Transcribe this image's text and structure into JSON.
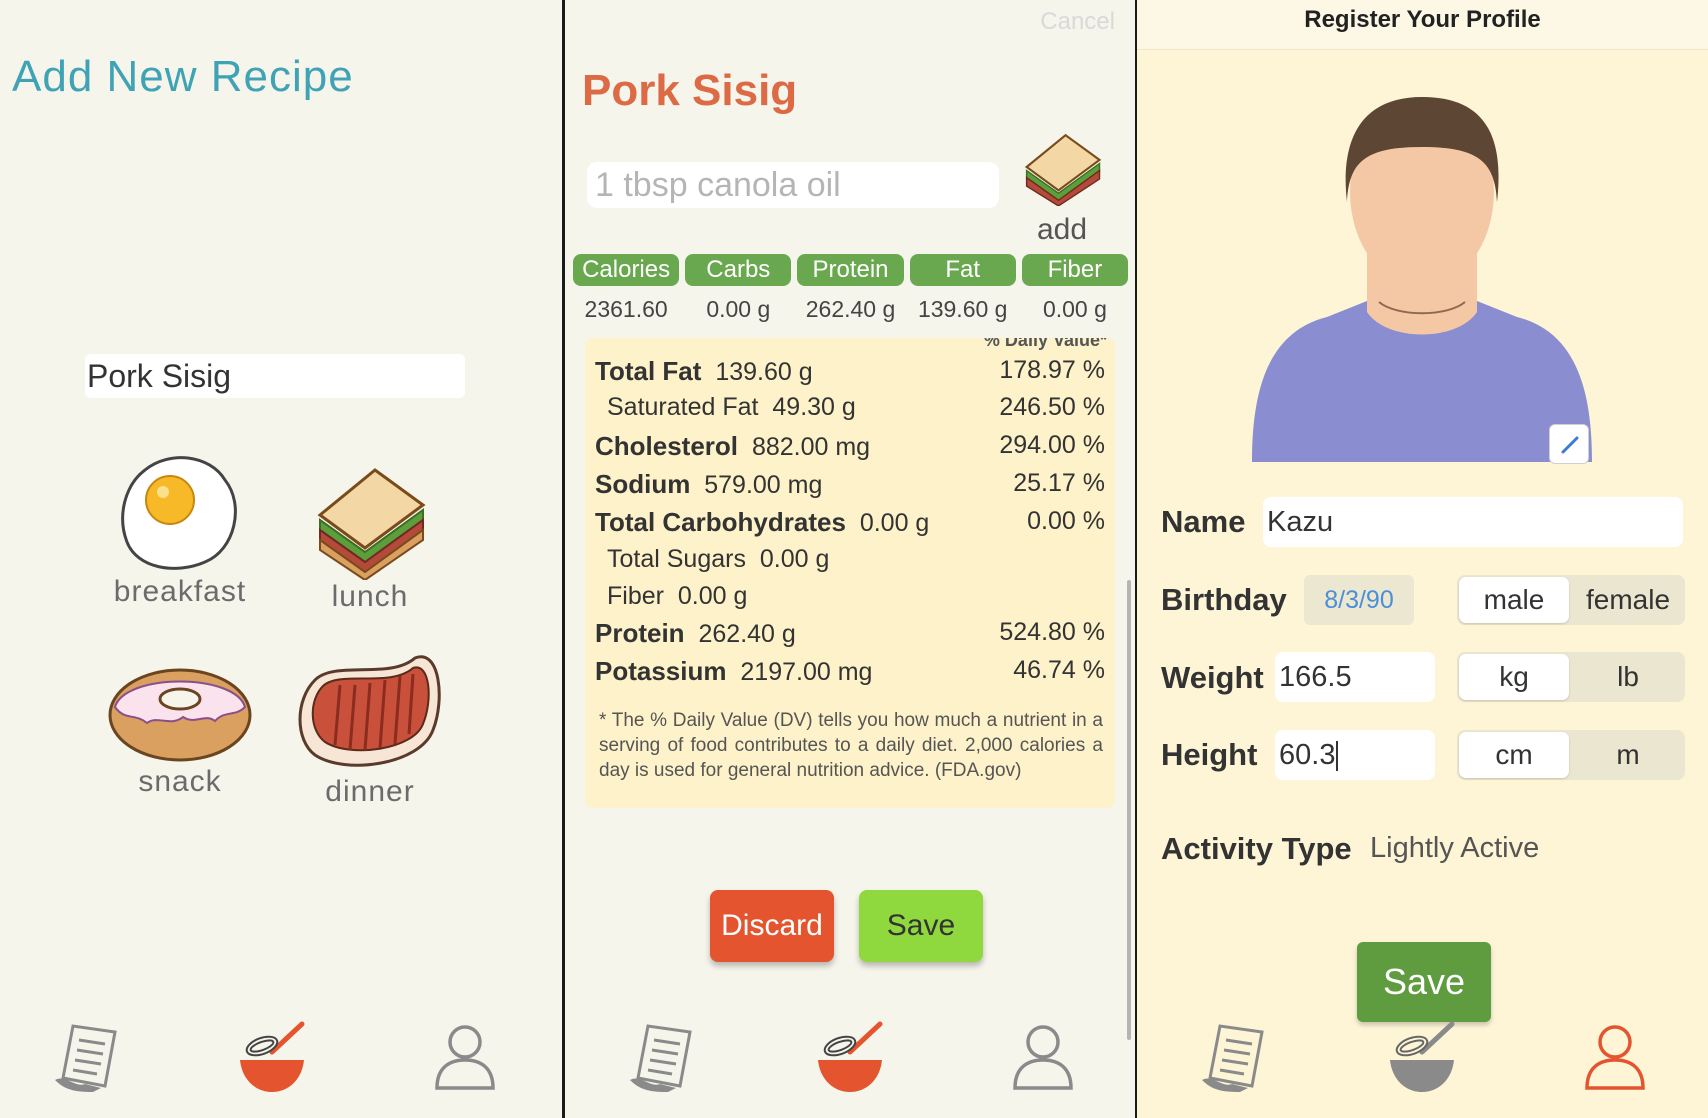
{
  "recipe_panel": {
    "title": "Add New Recipe",
    "recipe_name_value": "Pork Sisig",
    "meals": [
      {
        "label": "breakfast",
        "icon": "fried-egg-icon"
      },
      {
        "label": "lunch",
        "icon": "sandwich-icon"
      },
      {
        "label": "snack",
        "icon": "donut-icon"
      },
      {
        "label": "dinner",
        "icon": "steak-icon"
      }
    ]
  },
  "ingredient_panel": {
    "cancel_label": "Cancel",
    "title": "Pork Sisig",
    "ingredient_input_value": "1 tbsp canola oil",
    "add_label": "add",
    "nutrients": [
      {
        "label": "Calories",
        "value": "2361.60"
      },
      {
        "label": "Carbs",
        "value": "0.00 g"
      },
      {
        "label": "Protein",
        "value": "262.40 g"
      },
      {
        "label": "Fat",
        "value": "139.60 g"
      },
      {
        "label": "Fiber",
        "value": "0.00 g"
      }
    ],
    "daily_value_header": "% Daily Value*",
    "facts": [
      {
        "name": "Total Fat",
        "amount": "139.60 g",
        "pct": "178.97 %",
        "sub": false
      },
      {
        "name": "Saturated Fat",
        "amount": "49.30 g",
        "pct": "246.50 %",
        "sub": true
      },
      {
        "name": "Cholesterol",
        "amount": "882.00 mg",
        "pct": "294.00 %",
        "sub": false
      },
      {
        "name": "Sodium",
        "amount": "579.00 mg",
        "pct": "25.17 %",
        "sub": false
      },
      {
        "name": "Total Carbohydrates",
        "amount": "0.00 g",
        "pct": "0.00 %",
        "sub": false
      },
      {
        "name": "Total Sugars",
        "amount": "0.00 g",
        "pct": "",
        "sub": true
      },
      {
        "name": "Fiber",
        "amount": "0.00 g",
        "pct": "",
        "sub": true
      },
      {
        "name": "Protein",
        "amount": "262.40 g",
        "pct": "524.80 %",
        "sub": false
      },
      {
        "name": "Potassium",
        "amount": "2197.00 mg",
        "pct": "46.74 %",
        "sub": false
      }
    ],
    "footnote": "* The % Daily Value (DV) tells you how much a nutrient in a serving of food contributes to a daily diet. 2,000 calories a day is used for general nutrition advice. (FDA.gov)",
    "discard_label": "Discard",
    "save_label": "Save"
  },
  "profile_panel": {
    "header": "Register Your Profile",
    "name_label": "Name",
    "name_value": "Kazu",
    "birthday_label": "Birthday",
    "birthday_value": "8/3/90",
    "gender_options": [
      "male",
      "female"
    ],
    "weight_label": "Weight",
    "weight_value": "166.5",
    "weight_units": [
      "kg",
      "lb"
    ],
    "height_label": "Height",
    "height_value": "60.3",
    "height_units": [
      "cm",
      "m"
    ],
    "activity_label": "Activity Type",
    "activity_value": "Lightly Active",
    "save_label": "Save"
  },
  "tabbar": {
    "items": [
      "recipe-list-icon",
      "whisk-bowl-icon",
      "profile-icon"
    ],
    "active_color": "#e4552f",
    "inactive_color": "#8a8a8a"
  },
  "colors": {
    "accent_teal": "#3fa3b5",
    "title_orange": "#dc6a45",
    "nutrient_green": "#6aa84f",
    "save_green": "#8fd93f",
    "profile_save_green": "#5f9b3f",
    "discard_red": "#e4552f"
  }
}
